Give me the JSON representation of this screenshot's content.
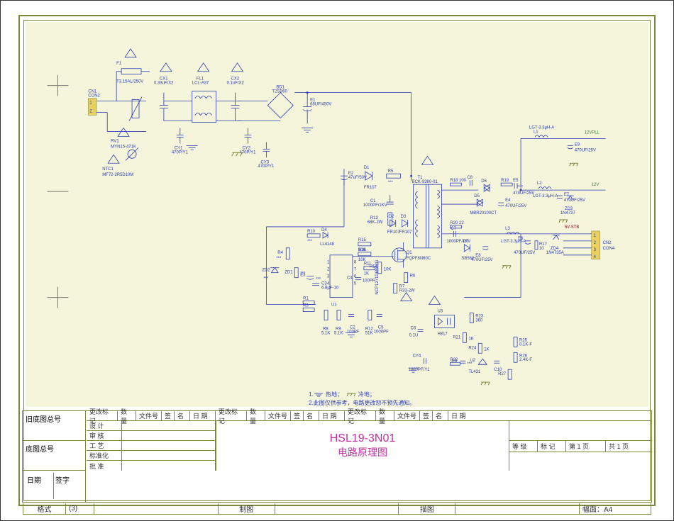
{
  "meta": {
    "project": "HSL19-3N01",
    "subtitle": "电路原理图",
    "format_label": "格式",
    "format_value": "(3)",
    "sheet_size": "A4",
    "drawer_label": "制图",
    "tracer_label": "描图",
    "paper_label": "幅面：A4",
    "page_current": "第 1 页",
    "page_total": "共 1 页",
    "level_label": "等  级",
    "mark_label": "标  记",
    "old_basemap_label": "旧底图总号",
    "basemap_label": "底图总号",
    "date_label": "日期",
    "sign_label": "签字"
  },
  "revision_headers": {
    "change_mark": "更改标记",
    "qty": "数量",
    "file_no": "文件号",
    "sign": "签",
    "name": "名",
    "date": "日    期"
  },
  "approval_rows": {
    "design": "设  计",
    "review": "审  核",
    "process": "工  艺",
    "standard": "标准化",
    "approve": "批  准"
  },
  "notes": {
    "n1a": "1.",
    "n1b": "热地；",
    "n1c": "冷地；",
    "n2": "2.此图仅供参考，电路更改恕不预先通知。"
  },
  "nets": {
    "pll12v": "12VPLL",
    "v12": "12V",
    "stb5v": "5V-STB"
  },
  "connectors": {
    "cn1": {
      "ref": "CN1",
      "type": "CON2",
      "pins": [
        "1",
        "2"
      ]
    },
    "cn2": {
      "ref": "CN2",
      "type": "CON4",
      "pins": [
        "1",
        "2",
        "3",
        "4"
      ]
    }
  },
  "components": {
    "F1": "T3.15AL/250V",
    "CX1": "0.33uF/X2",
    "FL1": "LCL-A37",
    "CX2": "0.1uF/X2",
    "RV1": "MYN15-471K",
    "NTC1": "MF72-2R5D10M",
    "CY1": "470P/Y1",
    "CY2": "470P/Y1",
    "CY3": "470P/Y1",
    "BD1": "T2SB60",
    "E1": "68UF/450V",
    "E2": "47uF/50V",
    "D1": "FR107",
    "R5": "***",
    "R13": "68K-2W",
    "C1": "1000PF/1KV",
    "T1": "BCK-9380-01",
    "R20": "22",
    "C7": "1000PF/1KV",
    "D5": "MBR20100CT",
    "E4": "470UF/25V",
    "D2": "FR107",
    "D3": "FR107",
    "D7": "SB560",
    "L3": "LGT-3.3μH-A",
    "R10": "***",
    "D4": "LL4148",
    "R15": "10K",
    "R16": "10K",
    "R14": "10K",
    "U1": "NCP1271D65R2G",
    "Q1": "FQPF8N60C",
    "R11": "1K",
    "C4": "100PF",
    "R4": "***",
    "ZD2": "***",
    "ZD1": "***",
    "E3": "***",
    "C3": "6.8μF-10",
    "C2": "100PF",
    "R8": "5.1K",
    "R9": "5.1K",
    "R12": "51K",
    "C5": "1000PF",
    "R7": "R33-2W",
    "U3": "H817",
    "C6": "0.1U",
    "R23": "360",
    "R21": "1K",
    "R24": "1K",
    "CY4": "1000PF/Y1",
    "R22": "***",
    "C9": "***",
    "U2": "TL431",
    "C10": "***",
    "R25": "0.1K-F",
    "R26": "2.4K-F",
    "C8": "***/***",
    "R27": "***",
    "R18": "100",
    "R19": "***",
    "E5": "470UF/25V",
    "D6": "***",
    "E8": "470UF/25V",
    "L1": "LGT-3.3μH-A",
    "L2": "LGT-3.3μH-A",
    "E7": "470UF/25V",
    "E6": "470UF/25V",
    "ZD3": "1N4737",
    "R17": "10",
    "ZD4": "1N4735A",
    "R6": "***",
    "R1": "***",
    "R3": "***"
  }
}
